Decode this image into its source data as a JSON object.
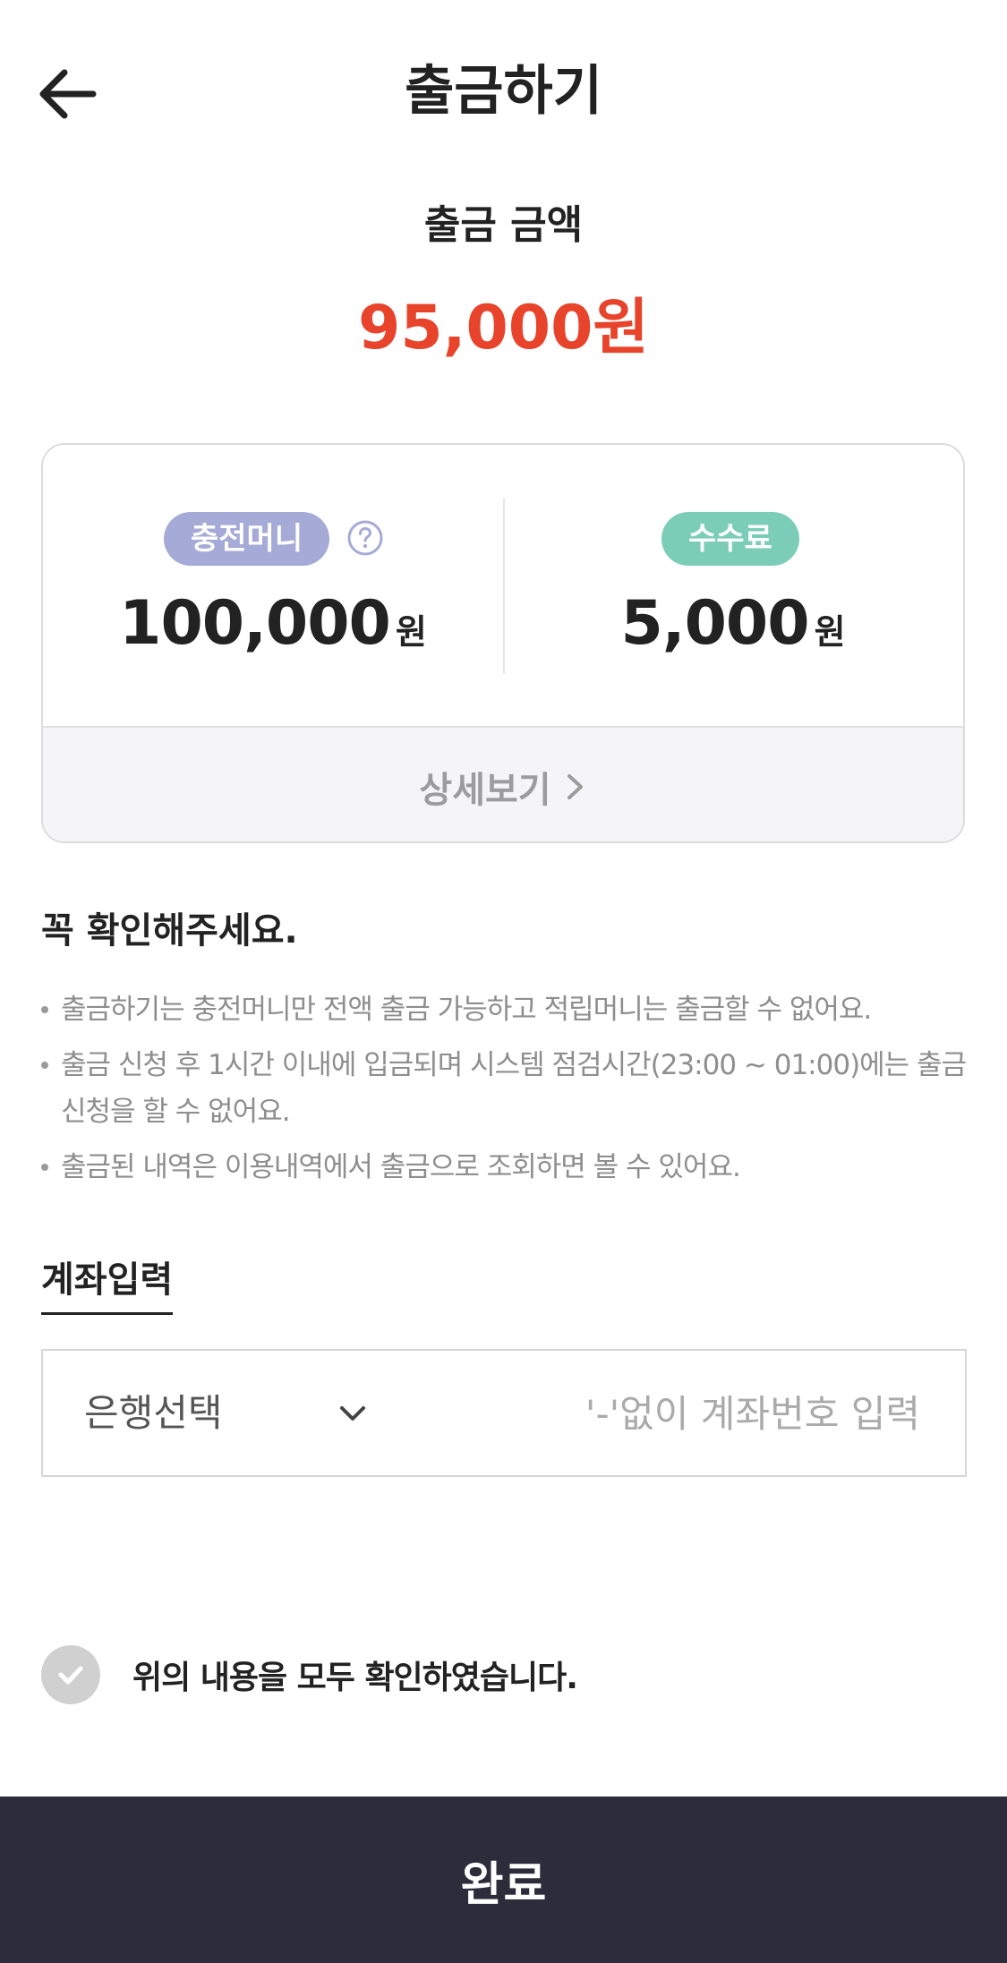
{
  "header": {
    "title": "출금하기",
    "back_icon": "arrow-left-icon"
  },
  "withdrawal": {
    "amount_label": "출금 금액",
    "amount_value": "95,000원",
    "accent_color": "#e8432b"
  },
  "summary": {
    "charge": {
      "label": "충전머니",
      "amount": "100,000",
      "unit": "원",
      "pill_color": "#a5aad6"
    },
    "fee": {
      "label": "수수료",
      "amount": "5,000",
      "unit": "원",
      "pill_color": "#7bcdb8"
    },
    "details_label": "상세보기"
  },
  "notice": {
    "title": "꼭 확인해주세요.",
    "items": [
      "출금하기는 충전머니만 전액 출금 가능하고 적립머니는 출금할 수 없어요.",
      "출금 신청 후 1시간 이내에 입금되며 시스템 점검시간(23:00 ~ 01:00)에는 출금 신청을 할 수 없어요.",
      "출금된 내역은 이용내역에서 출금으로 조회하면 볼 수 있어요."
    ]
  },
  "account": {
    "title": "계좌입력",
    "bank_select_label": "은행선택",
    "account_placeholder": "'-'없이 계좌번호 입력",
    "account_value": ""
  },
  "agreement": {
    "text": "위의 내용을 모두 확인하였습니다.",
    "checked": false
  },
  "footer": {
    "done_label": "완료",
    "button_color": "#2c2c3b"
  }
}
